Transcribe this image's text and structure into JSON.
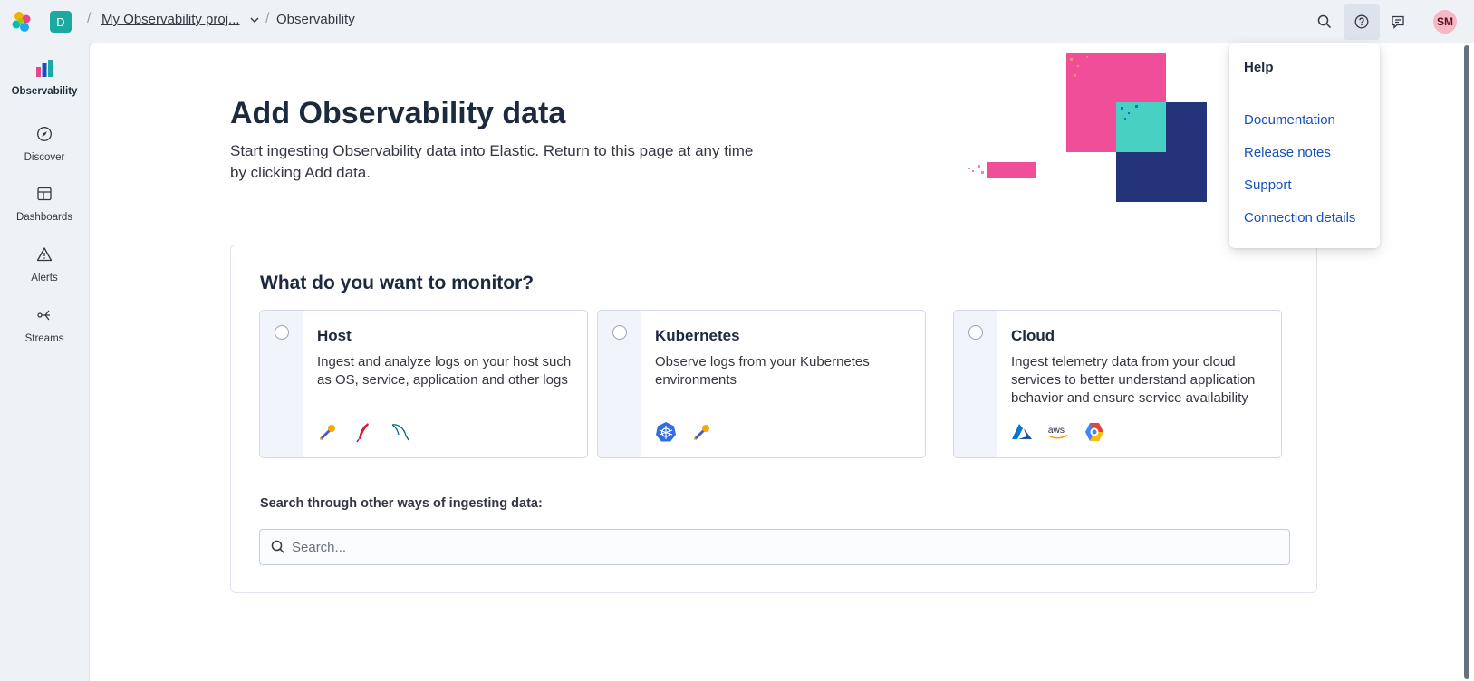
{
  "header": {
    "space_initial": "D",
    "project_name": "My Observability proj...",
    "current_page": "Observability",
    "avatar_initials": "SM"
  },
  "sidebar": {
    "items": [
      {
        "label": "Observability"
      },
      {
        "label": "Discover"
      },
      {
        "label": "Dashboards"
      },
      {
        "label": "Alerts"
      },
      {
        "label": "Streams"
      }
    ]
  },
  "page": {
    "title": "Add Observability data",
    "description": "Start ingesting Observability data into Elastic. Return to this page at any time by clicking Add data."
  },
  "monitor": {
    "question": "What do you want to monitor?",
    "cards": [
      {
        "title": "Host",
        "description": "Ingest and analyze logs on your host such as OS, service, application and other logs",
        "logos": [
          "otel-icon",
          "feather-icon",
          "mysql-dolphin-icon"
        ]
      },
      {
        "title": "Kubernetes",
        "description": "Observe logs from your Kubernetes environments",
        "logos": [
          "kubernetes-icon",
          "otel-icon"
        ]
      },
      {
        "title": "Cloud",
        "description": "Ingest telemetry data from your cloud services to better understand application behavior and ensure service availability",
        "logos": [
          "azure-icon",
          "aws-icon",
          "gcp-icon"
        ]
      }
    ],
    "aws_text": "aws",
    "search_label": "Search through other ways of ingesting data:",
    "search_placeholder": "Search..."
  },
  "help_menu": {
    "title": "Help",
    "links": [
      {
        "label": "Documentation"
      },
      {
        "label": "Release notes"
      },
      {
        "label": "Support"
      },
      {
        "label": "Connection details"
      }
    ]
  },
  "colors": {
    "accent_link": "#1750ba",
    "space_badge": "#1ba9a1",
    "avatar_bg": "#f6b8c2"
  }
}
